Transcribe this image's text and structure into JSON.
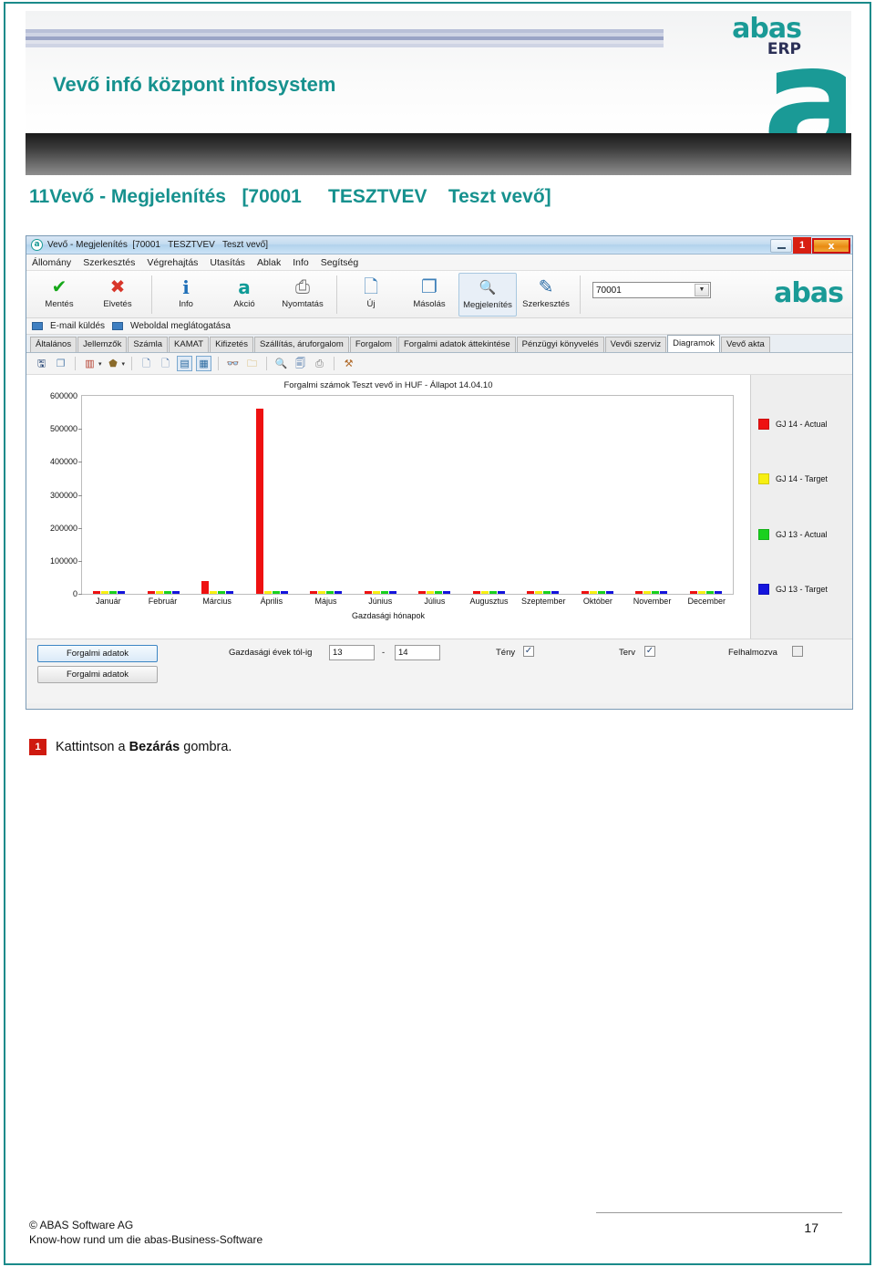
{
  "banner": {
    "title": "Vevő infó központ infosystem",
    "logo_word": "abas",
    "logo_erp": "ERP",
    "logo_mark": "a"
  },
  "subtitle": "11Vevő - Megjelenítés   [70001     TESZTVEV    Teszt vevő]",
  "window": {
    "titlebar": {
      "app_icon": "a",
      "title": "Vevő - Megjelenítés  [70001   TESZTVEV   Teszt vevő]",
      "minimize_icon": "minimize-icon",
      "badge": "1",
      "close_label": "x"
    },
    "menu": [
      "Állomány",
      "Szerkesztés",
      "Végrehajtás",
      "Utasítás",
      "Ablak",
      "Info",
      "Segítség"
    ],
    "toolbar": [
      {
        "label": "Mentés",
        "icon": "check-icon",
        "glyph": "✔",
        "color": "#17a81a",
        "selected": false
      },
      {
        "label": "Elvetés",
        "icon": "cross-icon",
        "glyph": "✖",
        "color": "#d8362a",
        "selected": false
      },
      {
        "label": "Info",
        "icon": "info-icon",
        "glyph": "i",
        "color": "#1f6fb8",
        "selected": false
      },
      {
        "label": "Akció",
        "icon": "abas-a-icon",
        "glyph": "a",
        "color": "#0f9b97",
        "selected": false
      },
      {
        "label": "Nyomtatás",
        "icon": "printer-icon",
        "glyph": "⎙",
        "color": "#6d6d6d",
        "selected": false
      },
      {
        "label": "Új",
        "icon": "new-document-icon",
        "glyph": "🗋",
        "color": "#3d7fb8",
        "selected": false
      },
      {
        "label": "Másolás",
        "icon": "copy-icon",
        "glyph": "❐",
        "color": "#3d7fb8",
        "selected": false
      },
      {
        "label": "Megjelenítés",
        "icon": "magnifier-icon",
        "glyph": "🔍",
        "color": "#2f6fa8",
        "selected": true
      },
      {
        "label": "Szerkesztés",
        "icon": "pencil-edit-icon",
        "glyph": "✎",
        "color": "#2f6fa8",
        "selected": false
      }
    ],
    "record_selector": {
      "value": "70001",
      "dropdown_icon": "chevron-down-icon"
    },
    "toolbar_logo": "abas",
    "quicklinks": [
      {
        "label": "E-mail küldés",
        "icon": "mail-icon"
      },
      {
        "label": "Weboldal meglátogatása",
        "icon": "web-icon"
      }
    ],
    "tabs": [
      {
        "label": "Általános",
        "active": false
      },
      {
        "label": "Jellemzők",
        "active": false
      },
      {
        "label": "Számla",
        "active": false
      },
      {
        "label": "KAMAT",
        "active": false
      },
      {
        "label": "Kifizetés",
        "active": false
      },
      {
        "label": "Szállítás, áruforgalom",
        "active": false
      },
      {
        "label": "Forgalom",
        "active": false
      },
      {
        "label": "Forgalmi adatok áttekintése",
        "active": false
      },
      {
        "label": "Pénzügyi könyvelés",
        "active": false
      },
      {
        "label": "Vevői szerviz",
        "active": false
      },
      {
        "label": "Diagramok",
        "active": true
      },
      {
        "label": "Vevő akta",
        "active": false
      }
    ],
    "chart_toolbar": [
      {
        "icon": "save-icon",
        "glyph": "🖫",
        "color": "#2b4a78",
        "framed": false
      },
      {
        "icon": "copy-icon",
        "glyph": "❐",
        "color": "#5a84b0",
        "framed": false
      },
      {
        "icon": "chart-type-icon",
        "glyph": "▥",
        "color": "#b33a2a",
        "framed": false
      },
      {
        "icon": "chart-type-dropdown-icon",
        "glyph": "▾",
        "color": "#333333",
        "framed": false
      },
      {
        "icon": "fill-color-icon",
        "glyph": "⬟",
        "color": "#8a6a2a",
        "framed": false
      },
      {
        "icon": "fill-color-dropdown-icon",
        "glyph": "▾",
        "color": "#333333",
        "framed": false
      },
      {
        "icon": "page-icon",
        "glyph": "🗋",
        "color": "#4a74a8",
        "framed": false
      },
      {
        "icon": "page-save-icon",
        "glyph": "🗋",
        "color": "#4a74a8",
        "framed": false
      },
      {
        "icon": "chart-view-icon",
        "glyph": "▤",
        "color": "#2b6aa0",
        "framed": true
      },
      {
        "icon": "table-view-icon",
        "glyph": "▦",
        "color": "#2b6aa0",
        "framed": true
      },
      {
        "icon": "binoculars-icon",
        "glyph": "👓",
        "color": "#1d6f66",
        "framed": false
      },
      {
        "icon": "folder-export-icon",
        "glyph": "🗀",
        "color": "#c79a2a",
        "framed": false
      },
      {
        "icon": "zoom-icon",
        "glyph": "🔍",
        "color": "#a86b2a",
        "framed": false
      },
      {
        "icon": "print-preview-icon",
        "glyph": "🗐",
        "color": "#4a74a8",
        "framed": false
      },
      {
        "icon": "print-icon",
        "glyph": "⎙",
        "color": "#7a7a7a",
        "framed": false
      },
      {
        "icon": "tools-icon",
        "glyph": "⚒",
        "color": "#b06a2a",
        "framed": false
      }
    ],
    "controls": {
      "button_primary": "Forgalmi adatok",
      "button_secondary": "Forgalmi adatok",
      "year_range_label": "Gazdasági évek tól-ig",
      "year_from": "13",
      "year_dash": "-",
      "year_to": "14",
      "checkbox_actual_label": "Tény",
      "checkbox_actual_checked": true,
      "checkbox_plan_label": "Terv",
      "checkbox_plan_checked": true,
      "checkbox_cumulative_label": "Felhalmozva",
      "checkbox_cumulative_checked": false,
      "check_glyph": "✓"
    }
  },
  "chart_data": {
    "type": "bar",
    "title": "Forgalmi számok Teszt vevő in HUF - Állapot 14.04.10",
    "xlabel": "Gazdasági hónapok",
    "ylabel": "",
    "ylim": [
      0,
      600000
    ],
    "yticks": [
      600000,
      500000,
      400000,
      300000,
      200000,
      100000,
      0
    ],
    "ytick_labels": [
      "600000",
      "500000",
      "400000",
      "300000",
      "200000",
      "100000",
      "0"
    ],
    "grid": false,
    "legend_position": "right",
    "categories": [
      "Január",
      "Február",
      "Március",
      "Április",
      "Május",
      "Június",
      "Július",
      "Augusztus",
      "Szeptember",
      "Október",
      "November",
      "December"
    ],
    "series": [
      {
        "name": "GJ 14 - Actual",
        "color": "#ee1111",
        "values": [
          0,
          0,
          40000,
          560000,
          0,
          0,
          0,
          0,
          0,
          0,
          0,
          0
        ]
      },
      {
        "name": "GJ 14 - Target",
        "color": "#f7ef12",
        "values": [
          0,
          0,
          0,
          0,
          0,
          0,
          0,
          0,
          0,
          0,
          0,
          0
        ]
      },
      {
        "name": "GJ 13 - Actual",
        "color": "#19d11e",
        "values": [
          0,
          0,
          0,
          0,
          0,
          0,
          0,
          0,
          0,
          0,
          0,
          0
        ]
      },
      {
        "name": "GJ 13 - Target",
        "color": "#1414dd",
        "values": [
          0,
          0,
          0,
          0,
          0,
          0,
          0,
          0,
          0,
          0,
          0,
          0
        ]
      }
    ]
  },
  "caption": {
    "badge": "1",
    "text_before": "Kattintson a ",
    "text_bold": "Bezárás",
    "text_after": " gombra."
  },
  "footer": {
    "page_number": "17",
    "copyright_line1": "© ABAS Software AG",
    "copyright_line2": "Know-how rund um die abas-Business-Software"
  }
}
